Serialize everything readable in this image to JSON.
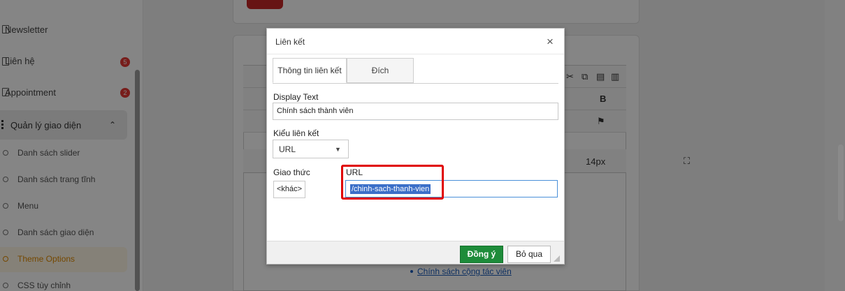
{
  "sidebar": {
    "items": [
      {
        "label": "Newsletter",
        "badge": ""
      },
      {
        "label": "Liên hệ",
        "badge": "5"
      },
      {
        "label": "Appointment",
        "badge": "2"
      }
    ],
    "group": {
      "label": "Quản lý giao diện",
      "caret": "⌃"
    },
    "sub_items": [
      {
        "label": "Danh sách slider"
      },
      {
        "label": "Danh sách trang tĩnh"
      },
      {
        "label": "Menu"
      },
      {
        "label": "Danh sách giao diện"
      },
      {
        "label": "Theme Options"
      },
      {
        "label": "CSS tùy chỉnh"
      }
    ]
  },
  "editor": {
    "font_size": "14px",
    "list_link": "Chính sách cộng tác viên"
  },
  "dialog": {
    "title": "Liên kết",
    "close": "×",
    "tabs": [
      {
        "label": "Thông tin liên kết"
      },
      {
        "label": "Đích"
      }
    ],
    "display_text_label": "Display Text",
    "display_text_value": "Chính sách thành viên",
    "link_type_label": "Kiểu liên kết",
    "link_type_value": "URL",
    "protocol_label": "Giao thức",
    "protocol_value": "<khác>",
    "url_label": "URL",
    "url_value": "/chinh-sach-thanh-vien",
    "ok_label": "Đồng ý",
    "cancel_label": "Bỏ qua"
  },
  "colors": {
    "ok_button": "#1e8c3a",
    "highlight_box": "#e00000",
    "badge": "#e53935",
    "active_sub": "#e08a00"
  }
}
